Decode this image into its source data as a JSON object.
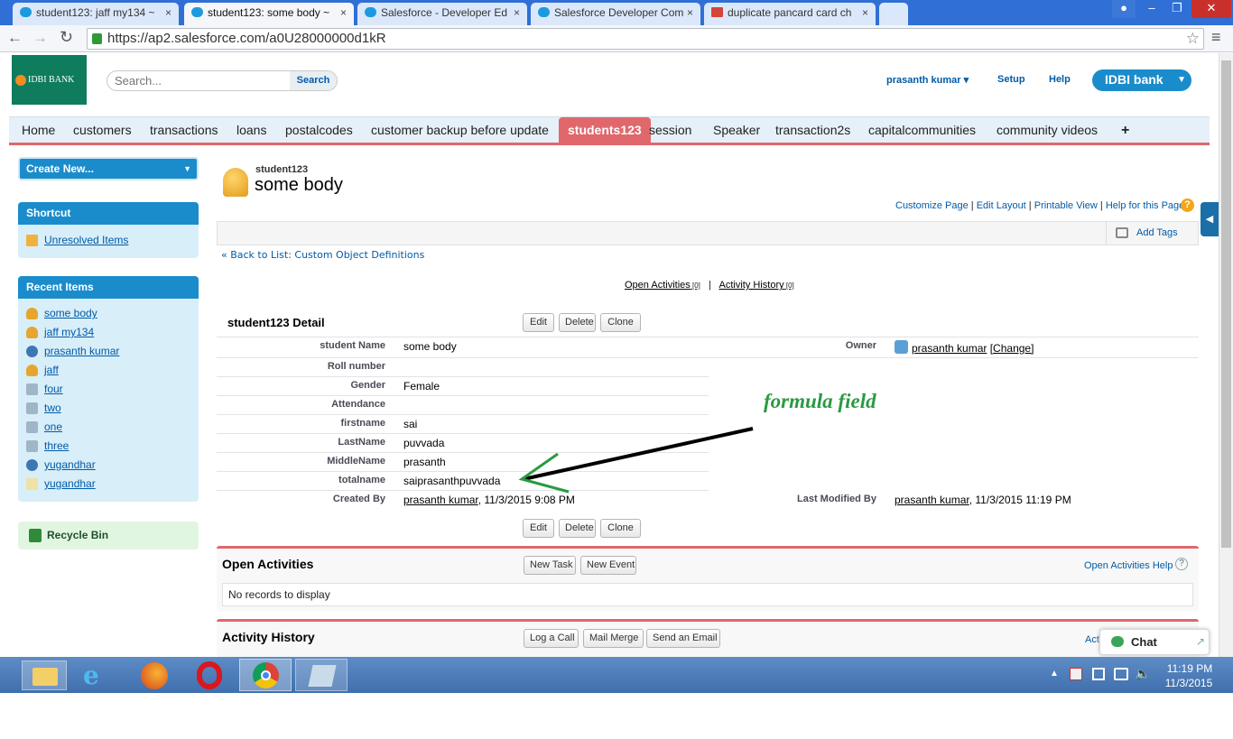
{
  "browser": {
    "tabs": [
      {
        "title": "student123: jaff my134 ~",
        "active": false
      },
      {
        "title": "student123: some body ~",
        "active": true
      },
      {
        "title": "Salesforce - Developer Ed",
        "active": false
      },
      {
        "title": "Salesforce Developer Com",
        "active": false
      },
      {
        "title": "duplicate pancard card ch",
        "active": false
      }
    ],
    "url": "https://ap2.salesforce.com/a0U28000000d1kR"
  },
  "header": {
    "logo_text": "IDBI BANK",
    "search_placeholder": "Search...",
    "search_button": "Search",
    "user_menu": "prasanth kumar",
    "setup": "Setup",
    "help": "Help",
    "app_switcher": "IDBI bank"
  },
  "nav_tabs": [
    "Home",
    "customers",
    "transactions",
    "loans",
    "postalcodes",
    "customer backup before update",
    "students123",
    "session",
    "Speaker",
    "transaction2s",
    "capitalcommunities",
    "community videos"
  ],
  "nav_selected": "students123",
  "nav_plus": "+",
  "sidebar": {
    "create_new": "Create New...",
    "shortcut_title": "Shortcut",
    "shortcut_item": "Unresolved Items",
    "recent_title": "Recent Items",
    "recent_items": [
      {
        "label": "some body",
        "icon": "bell-icon"
      },
      {
        "label": "jaff my134",
        "icon": "bell-icon"
      },
      {
        "label": "prasanth kumar",
        "icon": "user-icon"
      },
      {
        "label": "jaff",
        "icon": "bell-icon"
      },
      {
        "label": "four",
        "icon": "tab-icon"
      },
      {
        "label": "two",
        "icon": "tab-icon"
      },
      {
        "label": "one",
        "icon": "tab-icon"
      },
      {
        "label": "three",
        "icon": "tab-icon"
      },
      {
        "label": "yugandhar",
        "icon": "user-icon"
      },
      {
        "label": "yugandhar",
        "icon": "doc-icon"
      }
    ],
    "recycle_bin": "Recycle Bin"
  },
  "record": {
    "object_name": "student123",
    "record_name": "some body",
    "page_links": [
      "Customize Page",
      "Edit Layout",
      "Printable View",
      "Help for this Page"
    ],
    "add_tags": "Add Tags",
    "back_link": "« Back to List: Custom Object Definitions",
    "open_activities_link": "Open Activities",
    "open_activities_count": "[0]",
    "activity_history_link": "Activity History",
    "activity_history_count": "[0]",
    "detail_title": "student123 Detail",
    "buttons": [
      "Edit",
      "Delete",
      "Clone"
    ],
    "fields": [
      {
        "label": "student Name",
        "value": "some body"
      },
      {
        "label": "Roll number",
        "value": ""
      },
      {
        "label": "Gender",
        "value": "Female"
      },
      {
        "label": "Attendance",
        "value": ""
      },
      {
        "label": "firstname",
        "value": "sai"
      },
      {
        "label": "LastName",
        "value": "puvvada"
      },
      {
        "label": "MiddleName",
        "value": "prasanth"
      },
      {
        "label": "totalname",
        "value": "saiprasanthpuvvada"
      }
    ],
    "owner_label": "Owner",
    "owner_name": "prasanth kumar",
    "owner_change": "[Change]",
    "created_by_label": "Created By",
    "created_by_name": "prasanth kumar",
    "created_by_date": ", 11/3/2015 9:08 PM",
    "modified_label": "Last Modified By",
    "modified_name": "prasanth kumar",
    "modified_date": ", 11/3/2015 11:19 PM",
    "annotation": "formula field"
  },
  "open_activities": {
    "title": "Open Activities",
    "buttons": [
      "New Task",
      "New Event"
    ],
    "help": "Open Activities Help",
    "empty": "No records to display"
  },
  "activity_history": {
    "title": "Activity History",
    "buttons": [
      "Log a Call",
      "Mail Merge",
      "Send an Email"
    ],
    "help_partial": "Acti"
  },
  "chat": "Chat",
  "taskbar": {
    "time": "11:19 PM",
    "date": "11/3/2015"
  },
  "colors": {
    "nav_accent": "#e0676b",
    "sidebar_header": "#1b8ccb",
    "annotation": "#2a9a42"
  }
}
